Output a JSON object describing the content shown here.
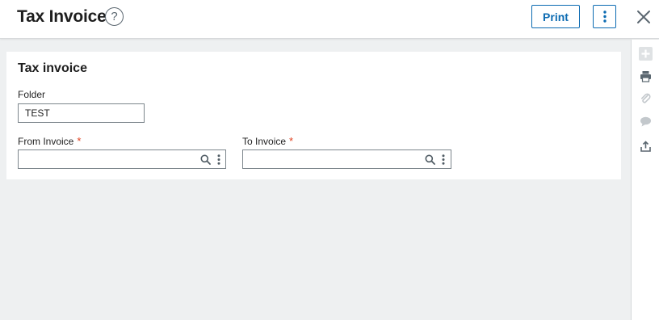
{
  "header": {
    "title": "Tax Invoice",
    "help_glyph": "?",
    "print_label": "Print",
    "more_icon": "more-vertical-icon",
    "close_icon": "close-icon"
  },
  "sidebar": {
    "icons": [
      "plus-icon",
      "printer-icon",
      "paperclip-icon",
      "comment-icon",
      "share-icon"
    ]
  },
  "form": {
    "title": "Tax invoice",
    "folder": {
      "label": "Folder",
      "value": "TEST"
    },
    "from_invoice": {
      "label": "From Invoice",
      "required_mark": "*",
      "value": ""
    },
    "to_invoice": {
      "label": "To Invoice",
      "required_mark": "*",
      "value": ""
    }
  },
  "colors": {
    "accent": "#0c6bb2",
    "required": "#e0401e",
    "background": "#eef0f1"
  }
}
